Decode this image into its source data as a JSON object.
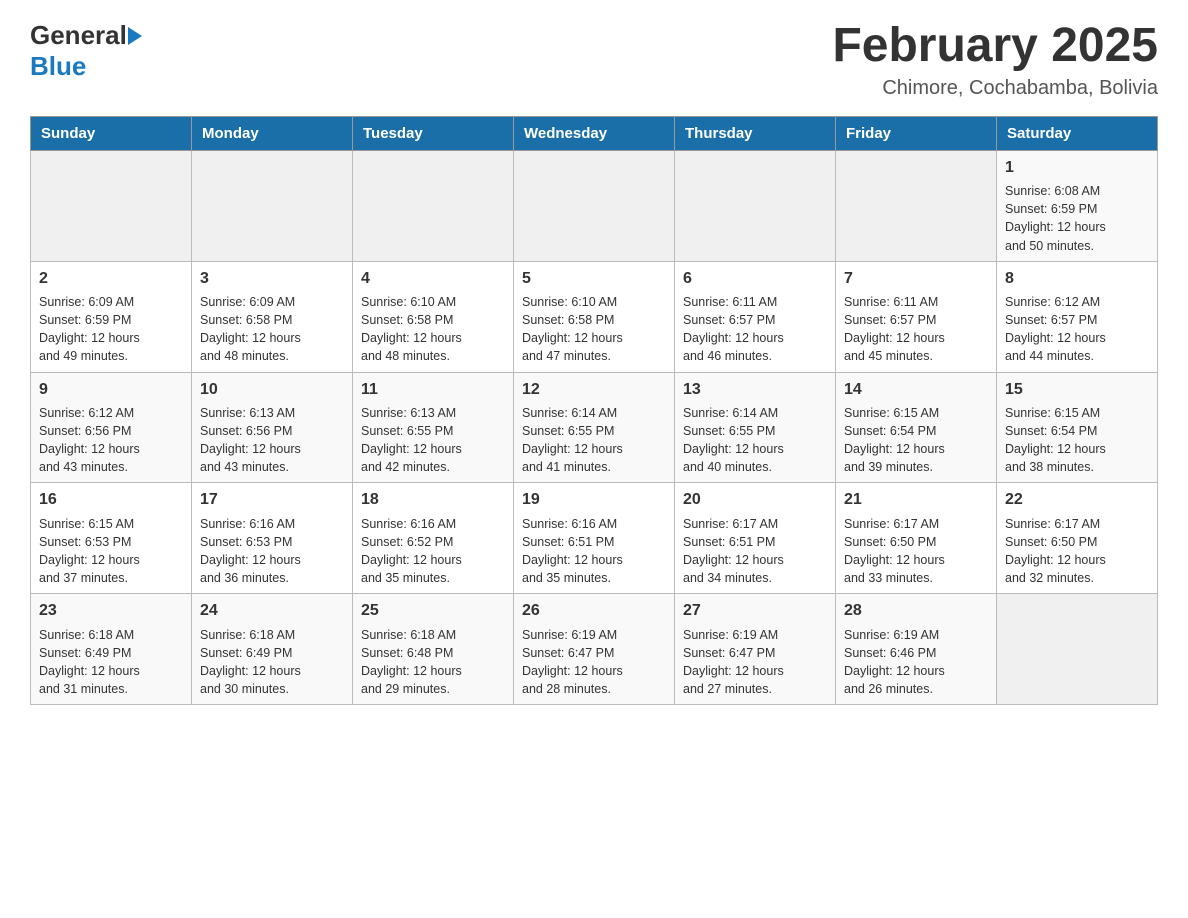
{
  "header": {
    "logo_general": "General",
    "logo_blue": "Blue",
    "month_title": "February 2025",
    "location": "Chimore, Cochabamba, Bolivia"
  },
  "weekdays": [
    "Sunday",
    "Monday",
    "Tuesday",
    "Wednesday",
    "Thursday",
    "Friday",
    "Saturday"
  ],
  "weeks": [
    [
      {
        "day": "",
        "info": ""
      },
      {
        "day": "",
        "info": ""
      },
      {
        "day": "",
        "info": ""
      },
      {
        "day": "",
        "info": ""
      },
      {
        "day": "",
        "info": ""
      },
      {
        "day": "",
        "info": ""
      },
      {
        "day": "1",
        "info": "Sunrise: 6:08 AM\nSunset: 6:59 PM\nDaylight: 12 hours\nand 50 minutes."
      }
    ],
    [
      {
        "day": "2",
        "info": "Sunrise: 6:09 AM\nSunset: 6:59 PM\nDaylight: 12 hours\nand 49 minutes."
      },
      {
        "day": "3",
        "info": "Sunrise: 6:09 AM\nSunset: 6:58 PM\nDaylight: 12 hours\nand 48 minutes."
      },
      {
        "day": "4",
        "info": "Sunrise: 6:10 AM\nSunset: 6:58 PM\nDaylight: 12 hours\nand 48 minutes."
      },
      {
        "day": "5",
        "info": "Sunrise: 6:10 AM\nSunset: 6:58 PM\nDaylight: 12 hours\nand 47 minutes."
      },
      {
        "day": "6",
        "info": "Sunrise: 6:11 AM\nSunset: 6:57 PM\nDaylight: 12 hours\nand 46 minutes."
      },
      {
        "day": "7",
        "info": "Sunrise: 6:11 AM\nSunset: 6:57 PM\nDaylight: 12 hours\nand 45 minutes."
      },
      {
        "day": "8",
        "info": "Sunrise: 6:12 AM\nSunset: 6:57 PM\nDaylight: 12 hours\nand 44 minutes."
      }
    ],
    [
      {
        "day": "9",
        "info": "Sunrise: 6:12 AM\nSunset: 6:56 PM\nDaylight: 12 hours\nand 43 minutes."
      },
      {
        "day": "10",
        "info": "Sunrise: 6:13 AM\nSunset: 6:56 PM\nDaylight: 12 hours\nand 43 minutes."
      },
      {
        "day": "11",
        "info": "Sunrise: 6:13 AM\nSunset: 6:55 PM\nDaylight: 12 hours\nand 42 minutes."
      },
      {
        "day": "12",
        "info": "Sunrise: 6:14 AM\nSunset: 6:55 PM\nDaylight: 12 hours\nand 41 minutes."
      },
      {
        "day": "13",
        "info": "Sunrise: 6:14 AM\nSunset: 6:55 PM\nDaylight: 12 hours\nand 40 minutes."
      },
      {
        "day": "14",
        "info": "Sunrise: 6:15 AM\nSunset: 6:54 PM\nDaylight: 12 hours\nand 39 minutes."
      },
      {
        "day": "15",
        "info": "Sunrise: 6:15 AM\nSunset: 6:54 PM\nDaylight: 12 hours\nand 38 minutes."
      }
    ],
    [
      {
        "day": "16",
        "info": "Sunrise: 6:15 AM\nSunset: 6:53 PM\nDaylight: 12 hours\nand 37 minutes."
      },
      {
        "day": "17",
        "info": "Sunrise: 6:16 AM\nSunset: 6:53 PM\nDaylight: 12 hours\nand 36 minutes."
      },
      {
        "day": "18",
        "info": "Sunrise: 6:16 AM\nSunset: 6:52 PM\nDaylight: 12 hours\nand 35 minutes."
      },
      {
        "day": "19",
        "info": "Sunrise: 6:16 AM\nSunset: 6:51 PM\nDaylight: 12 hours\nand 35 minutes."
      },
      {
        "day": "20",
        "info": "Sunrise: 6:17 AM\nSunset: 6:51 PM\nDaylight: 12 hours\nand 34 minutes."
      },
      {
        "day": "21",
        "info": "Sunrise: 6:17 AM\nSunset: 6:50 PM\nDaylight: 12 hours\nand 33 minutes."
      },
      {
        "day": "22",
        "info": "Sunrise: 6:17 AM\nSunset: 6:50 PM\nDaylight: 12 hours\nand 32 minutes."
      }
    ],
    [
      {
        "day": "23",
        "info": "Sunrise: 6:18 AM\nSunset: 6:49 PM\nDaylight: 12 hours\nand 31 minutes."
      },
      {
        "day": "24",
        "info": "Sunrise: 6:18 AM\nSunset: 6:49 PM\nDaylight: 12 hours\nand 30 minutes."
      },
      {
        "day": "25",
        "info": "Sunrise: 6:18 AM\nSunset: 6:48 PM\nDaylight: 12 hours\nand 29 minutes."
      },
      {
        "day": "26",
        "info": "Sunrise: 6:19 AM\nSunset: 6:47 PM\nDaylight: 12 hours\nand 28 minutes."
      },
      {
        "day": "27",
        "info": "Sunrise: 6:19 AM\nSunset: 6:47 PM\nDaylight: 12 hours\nand 27 minutes."
      },
      {
        "day": "28",
        "info": "Sunrise: 6:19 AM\nSunset: 6:46 PM\nDaylight: 12 hours\nand 26 minutes."
      },
      {
        "day": "",
        "info": ""
      }
    ]
  ]
}
